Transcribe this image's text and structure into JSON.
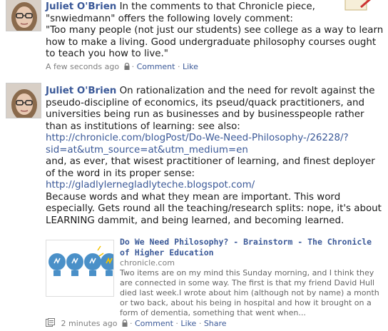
{
  "posts": [
    {
      "author": "Juliet O'Brien",
      "text": "In the comments to that Chronicle piece, \"snwiedmann\" offers the following lovely comment:\n\"Too many people (not just our students) see college as a way to learn how to make a living. Good undergraduate philosophy courses ought to teach you how to live.\"",
      "time": "A few seconds ago",
      "sep": "·",
      "actions": [
        "Comment",
        "Like"
      ]
    },
    {
      "author": "Juliet O'Brien",
      "text1": "On rationalization and the need for revolt against the pseudo-discipline of economics, its pseud/quack practitioners, and universities being run as businesses and by businesspeople rather than as institutions of learning: see also:",
      "link1": "http://chronicle.com/blogPost/Do-We-Need-Philosophy-/26228/?sid=at&utm_source=at&utm_medium=en",
      "text2": "and, as ever, that wisest practitioner of learning, and finest deployer of the word in its proper sense:",
      "link2": "http://gladlylernegladlyteche.blogspot.com/",
      "text3": "Because words and what they mean are important. This word especially. Gets round all the teaching/research splits: nope, it's about LEARNING dammit, and being learned, and becoming learned.",
      "attachment": {
        "title": "Do We Need Philosophy? - Brainstorm - The Chronicle of Higher Education",
        "domain": "chronicle.com",
        "description": "Two items are on my mind this Sunday morning, and I think they are connected in some way. The first is that my friend David Hull died last week.I wrote about him (although not by name) a month or two back, about his being in hospital and how it brought on a form of dementia, something that went when..."
      },
      "time": "2 minutes ago",
      "sep": "·",
      "actions": [
        "Comment",
        "Like",
        "Share"
      ]
    }
  ],
  "colors": {
    "link": "#3b5998",
    "meta": "#808080",
    "bulb_blue": "#4a90c8",
    "bulb_yellow": "#f5c400"
  }
}
